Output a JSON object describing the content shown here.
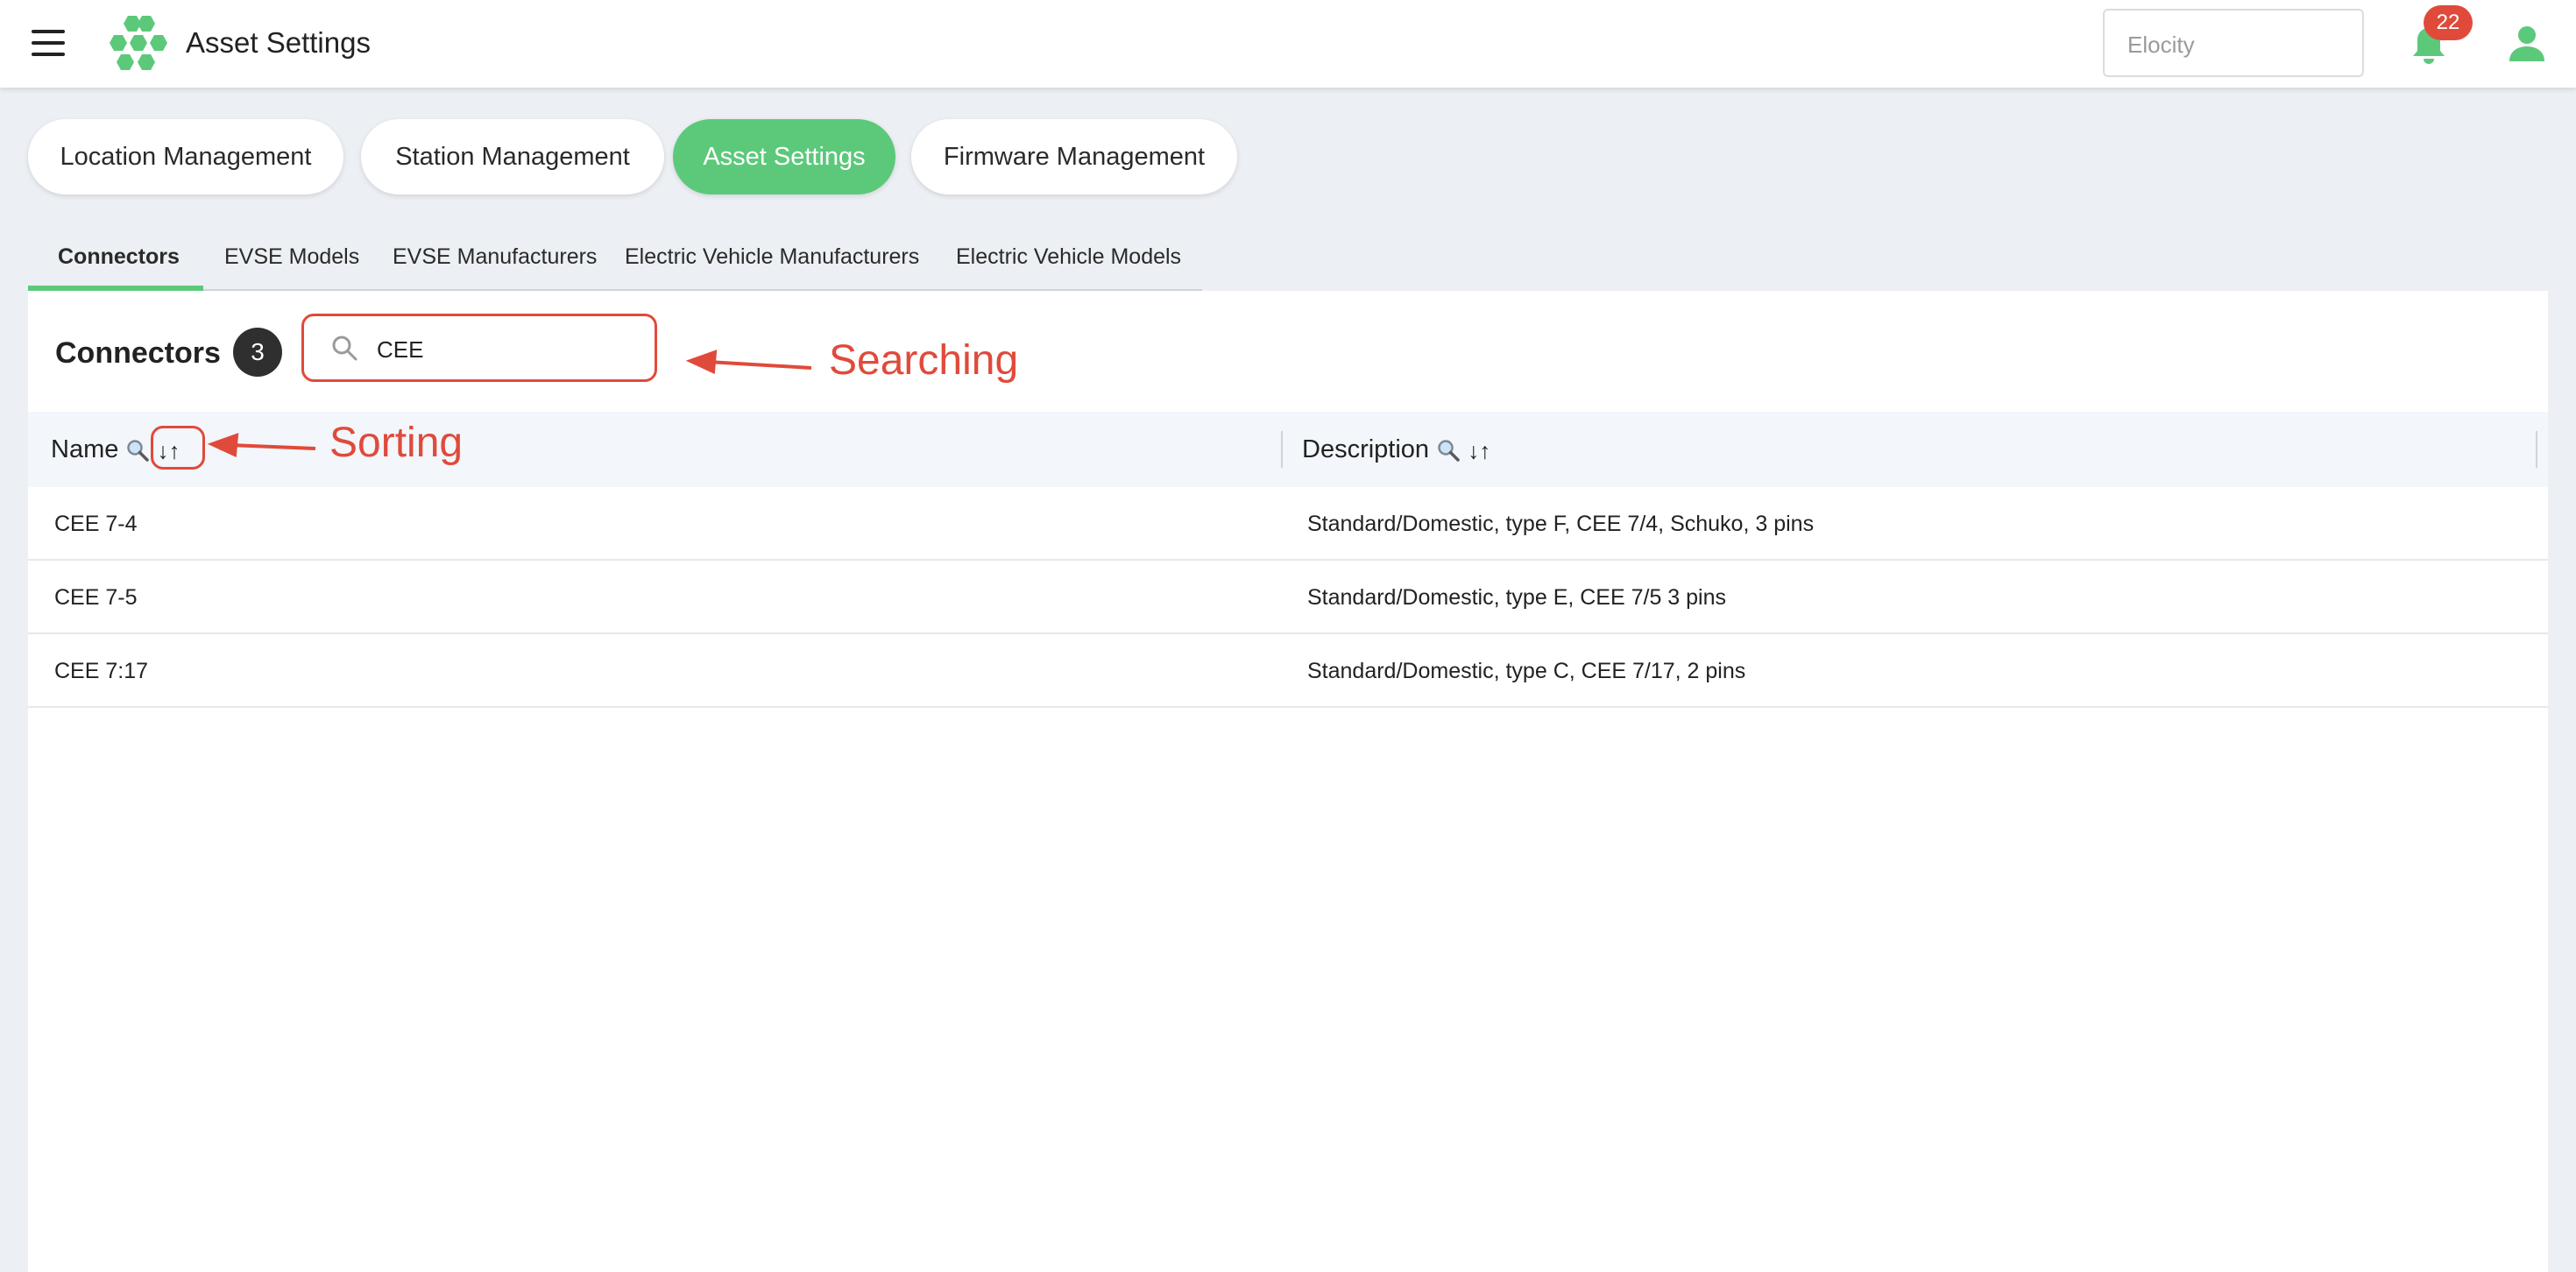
{
  "header": {
    "title": "Asset Settings",
    "org_placeholder": "Elocity",
    "notification_count": "22"
  },
  "module_tabs": [
    {
      "label": "Location Management",
      "active": false
    },
    {
      "label": "Station Management",
      "active": false
    },
    {
      "label": "Asset Settings",
      "active": true
    },
    {
      "label": "Firmware Management",
      "active": false
    }
  ],
  "sub_tabs": [
    {
      "label": "Connectors",
      "active": true
    },
    {
      "label": "EVSE Models",
      "active": false
    },
    {
      "label": "EVSE Manufacturers",
      "active": false
    },
    {
      "label": "Electric Vehicle Manufacturers",
      "active": false
    },
    {
      "label": "Electric Vehicle Models",
      "active": false
    }
  ],
  "panel": {
    "title": "Connectors",
    "count": "3",
    "search_value": "CEE"
  },
  "table": {
    "columns": [
      {
        "label": "Name",
        "sort_glyph": "↓↑"
      },
      {
        "label": "Description",
        "sort_glyph": "↓↑"
      }
    ],
    "rows": [
      {
        "name": "CEE 7-4",
        "description": "Standard/Domestic, type F, CEE 7/4, Schuko, 3 pins"
      },
      {
        "name": "CEE 7-5",
        "description": "Standard/Domestic, type E, CEE 7/5 3 pins"
      },
      {
        "name": "CEE 7:17",
        "description": "Standard/Domestic, type C, CEE 7/17, 2 pins"
      }
    ]
  },
  "annotations": {
    "searching": "Searching",
    "sorting": "Sorting",
    "color": "#e04a3b"
  },
  "colors": {
    "accent": "#5cc97a",
    "badge": "#e04a3b"
  }
}
